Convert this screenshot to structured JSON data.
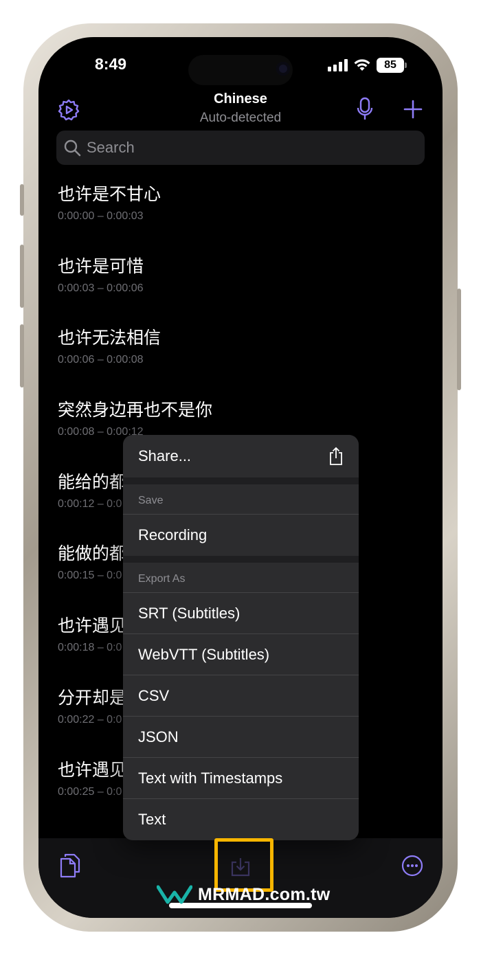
{
  "status_bar": {
    "time": "8:49",
    "battery": "85"
  },
  "nav": {
    "title": "Chinese",
    "subtitle": "Auto-detected"
  },
  "search": {
    "placeholder": "Search"
  },
  "segments": [
    {
      "text": "也许是不甘心",
      "time": "0:00:00 – 0:00:03"
    },
    {
      "text": "也许是可惜",
      "time": "0:00:03 – 0:00:06"
    },
    {
      "text": "也许无法相信",
      "time": "0:00:06 – 0:00:08"
    },
    {
      "text": "突然身边再也不是你",
      "time": "0:00:08 – 0:00:12"
    },
    {
      "text": "能给的都",
      "time": "0:00:12 – 0:0"
    },
    {
      "text": "能做的都",
      "time": "0:00:15 – 0:0"
    },
    {
      "text": "也许遇见",
      "time": "0:00:18 – 0:0"
    },
    {
      "text": "分开却是",
      "time": "0:00:22 – 0:0"
    },
    {
      "text": "也许遇见",
      "time": "0:00:25 – 0:0"
    }
  ],
  "menu": {
    "share_label": "Share...",
    "save_header": "Save",
    "recording_label": "Recording",
    "export_header": "Export As",
    "export_items": [
      "SRT (Subtitles)",
      "WebVTT (Subtitles)",
      "CSV",
      "JSON",
      "Text with Timestamps",
      "Text"
    ]
  },
  "watermark": {
    "brand": "MRMAD",
    "domain": ".com.tw"
  },
  "colors": {
    "accent": "#8e7cf7",
    "highlight": "#f7b500",
    "background": "#000000",
    "menu": "#2c2c2e"
  },
  "icons": {
    "settings": "gear-icon",
    "mic": "microphone-icon",
    "add": "plus-icon",
    "search": "search-icon",
    "share": "share-icon",
    "documents": "documents-icon",
    "export": "download-tray-icon",
    "more": "ellipsis-circle-icon"
  }
}
